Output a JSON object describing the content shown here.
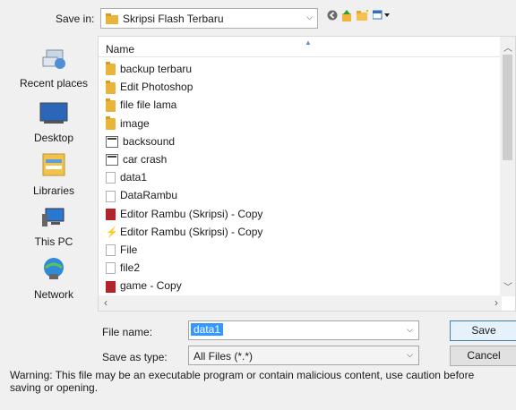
{
  "top": {
    "save_in_label": "Save in:",
    "folder_name": "Skripsi Flash Terbaru"
  },
  "places": [
    {
      "label": "Recent places",
      "icon": "recent-places-icon"
    },
    {
      "label": "Desktop",
      "icon": "desktop-icon"
    },
    {
      "label": "Libraries",
      "icon": "libraries-icon"
    },
    {
      "label": "This PC",
      "icon": "this-pc-icon"
    },
    {
      "label": "Network",
      "icon": "network-icon"
    }
  ],
  "list": {
    "column_name": "Name",
    "items": [
      {
        "name": "backup terbaru",
        "type": "folder"
      },
      {
        "name": "Edit Photoshop",
        "type": "folder"
      },
      {
        "name": "file file lama",
        "type": "folder"
      },
      {
        "name": "image",
        "type": "folder"
      },
      {
        "name": "backsound",
        "type": "flash-file"
      },
      {
        "name": "car crash",
        "type": "flash-file"
      },
      {
        "name": "data1",
        "type": "document"
      },
      {
        "name": "DataRambu",
        "type": "document"
      },
      {
        "name": "Editor Rambu (Skripsi) - Copy",
        "type": "fla"
      },
      {
        "name": "Editor Rambu (Skripsi) - Copy",
        "type": "swf"
      },
      {
        "name": "File",
        "type": "document"
      },
      {
        "name": "file2",
        "type": "document"
      },
      {
        "name": "game - Copy",
        "type": "fla"
      }
    ]
  },
  "form": {
    "file_name_label": "File name:",
    "file_name_value": "data1",
    "save_as_type_label": "Save as type:",
    "save_as_type_value": "All Files (*.*)"
  },
  "buttons": {
    "save": "Save",
    "cancel": "Cancel"
  },
  "warning": "Warning: This file may be an executable program or contain malicious content, use caution before saving or opening.",
  "colors": {
    "selection": "#3399ff",
    "folder": "#e8b53a",
    "fla": "#b4232a"
  }
}
